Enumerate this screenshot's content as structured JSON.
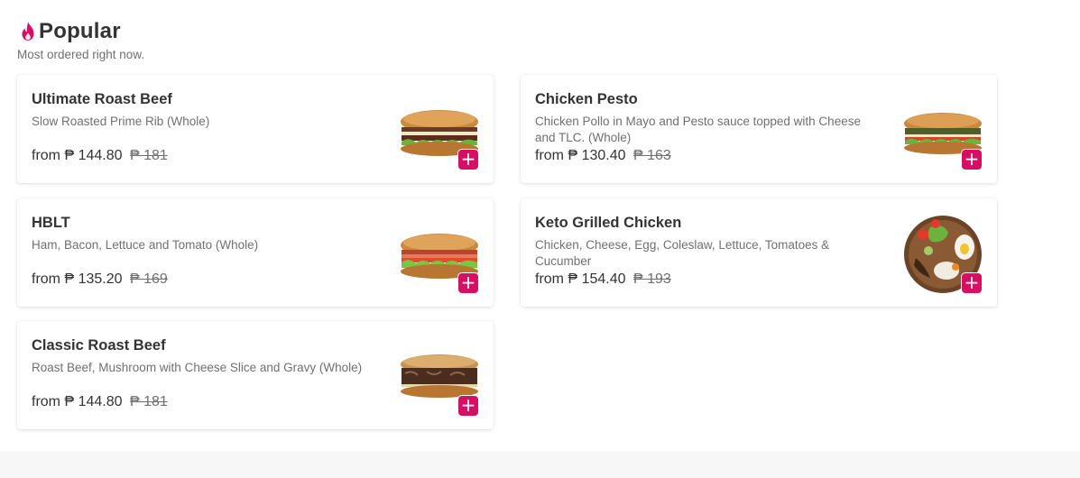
{
  "section": {
    "title": "Popular",
    "subtitle": "Most ordered right now.",
    "icon": "flame-icon"
  },
  "colors": {
    "accent": "#d70f64",
    "text": "#333333",
    "muted": "#707070"
  },
  "products": [
    {
      "name": "Ultimate Roast Beef",
      "description": "Slow Roasted Prime Rib (Whole)",
      "price_prefix": "from",
      "price": "₱ 144.80",
      "original_price": "₱ 181",
      "image": "sandwich-image",
      "add_label": "+"
    },
    {
      "name": "Chicken Pesto",
      "description": "Chicken Pollo in Mayo and Pesto sauce topped with Cheese and TLC. (Whole)",
      "price_prefix": "from",
      "price": "₱ 130.40",
      "original_price": "₱ 163",
      "image": "sandwich-image",
      "add_label": "+"
    },
    {
      "name": "HBLT",
      "description": "Ham, Bacon, Lettuce and Tomato (Whole)",
      "price_prefix": "from",
      "price": "₱ 135.20",
      "original_price": "₱ 169",
      "image": "sandwich-image",
      "add_label": "+"
    },
    {
      "name": "Keto Grilled Chicken",
      "description": "Chicken, Cheese, Egg, Coleslaw, Lettuce, Tomatoes & Cucumber",
      "price_prefix": "from",
      "price": "₱ 154.40",
      "original_price": "₱ 193",
      "image": "salad-bowl-image",
      "add_label": "+"
    },
    {
      "name": "Classic Roast Beef",
      "description": "Roast Beef, Mushroom with Cheese Slice and Gravy (Whole)",
      "price_prefix": "from",
      "price": "₱ 144.80",
      "original_price": "₱ 181",
      "image": "sandwich-image",
      "add_label": "+"
    }
  ]
}
